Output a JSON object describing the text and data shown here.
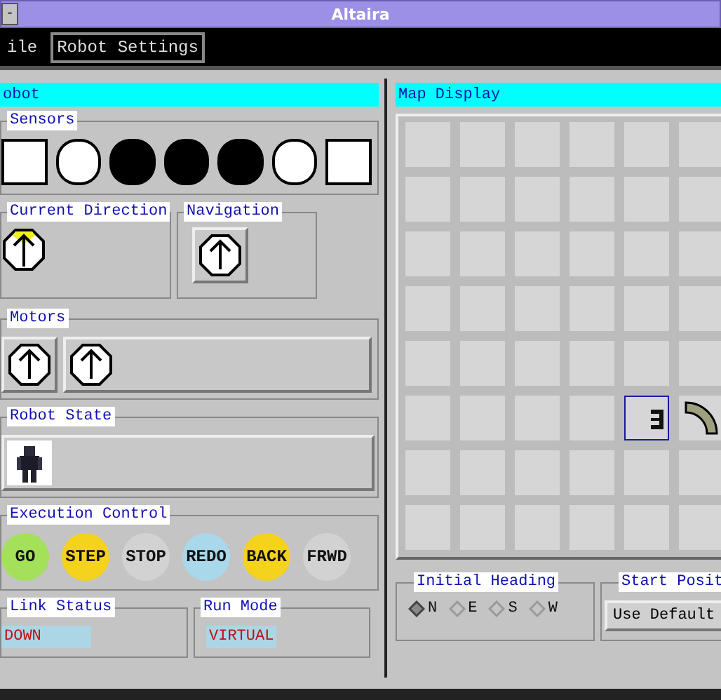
{
  "window": {
    "title": "Altaira",
    "control": "-"
  },
  "menu": [
    {
      "label": "ile",
      "boxed": false
    },
    {
      "label": "Robot Settings",
      "boxed": true
    }
  ],
  "robot_panel": {
    "title": "obot",
    "sensors": {
      "title": "Sensors",
      "items": [
        {
          "kind": "square",
          "active": false
        },
        {
          "kind": "circle",
          "active": false
        },
        {
          "kind": "circle",
          "active": true
        },
        {
          "kind": "circle",
          "active": true
        },
        {
          "kind": "circle",
          "active": true
        },
        {
          "kind": "circle",
          "active": false
        },
        {
          "kind": "square",
          "active": false
        }
      ]
    },
    "current_direction": {
      "title": "Current Direction"
    },
    "navigation": {
      "title": "Navigation"
    },
    "motors": {
      "title": "Motors"
    },
    "robot_state": {
      "title": "Robot State"
    },
    "execution_control": {
      "title": "Execution Control",
      "buttons": [
        {
          "label": "GO",
          "color": "#a4e05a"
        },
        {
          "label": "STEP",
          "color": "#f5d21c"
        },
        {
          "label": "STOP",
          "color": "#d2d2d2"
        },
        {
          "label": "REDO",
          "color": "#a8d8ea"
        },
        {
          "label": "BACK",
          "color": "#f5d21c"
        },
        {
          "label": "FRWD",
          "color": "#d2d2d2"
        }
      ]
    },
    "link_status": {
      "title": "Link Status",
      "value": "DOWN"
    },
    "run_mode": {
      "title": "Run Mode",
      "value": "VIRTUAL"
    }
  },
  "map_panel": {
    "title": "Map Display",
    "rows": [
      [
        {
          "kind": "empty"
        },
        {
          "kind": "empty"
        },
        {
          "kind": "empty"
        },
        {
          "kind": "empty"
        },
        {
          "kind": "empty"
        },
        {
          "kind": "empty"
        }
      ],
      [
        {
          "kind": "empty"
        },
        {
          "kind": "empty"
        },
        {
          "kind": "empty"
        },
        {
          "kind": "empty"
        },
        {
          "kind": "empty"
        },
        {
          "kind": "empty"
        }
      ],
      [
        {
          "kind": "empty"
        },
        {
          "kind": "empty"
        },
        {
          "kind": "empty"
        },
        {
          "kind": "empty"
        },
        {
          "kind": "empty"
        },
        {
          "kind": "empty"
        }
      ],
      [
        {
          "kind": "empty"
        },
        {
          "kind": "empty"
        },
        {
          "kind": "empty"
        },
        {
          "kind": "empty"
        },
        {
          "kind": "empty"
        },
        {
          "kind": "empty"
        }
      ],
      [
        {
          "kind": "empty"
        },
        {
          "kind": "empty"
        },
        {
          "kind": "empty"
        },
        {
          "kind": "empty"
        },
        {
          "kind": "empty"
        },
        {
          "kind": "empty"
        }
      ],
      [
        {
          "kind": "empty"
        },
        {
          "kind": "empty"
        },
        {
          "kind": "empty"
        },
        {
          "kind": "empty"
        },
        {
          "kind": "robot"
        },
        {
          "kind": "beam"
        }
      ],
      [
        {
          "kind": "empty"
        },
        {
          "kind": "empty"
        },
        {
          "kind": "empty"
        },
        {
          "kind": "empty"
        },
        {
          "kind": "empty"
        },
        {
          "kind": "empty"
        }
      ],
      [
        {
          "kind": "empty"
        },
        {
          "kind": "empty"
        },
        {
          "kind": "empty"
        },
        {
          "kind": "empty"
        },
        {
          "kind": "empty"
        },
        {
          "kind": "empty"
        }
      ]
    ],
    "initial_heading": {
      "title": "Initial Heading",
      "options": [
        {
          "label": "N",
          "selected": true
        },
        {
          "label": "E",
          "selected": false
        },
        {
          "label": "S",
          "selected": false
        },
        {
          "label": "W",
          "selected": false
        }
      ]
    },
    "start_position": {
      "title": "Start Posit",
      "button": "Use Default"
    }
  }
}
